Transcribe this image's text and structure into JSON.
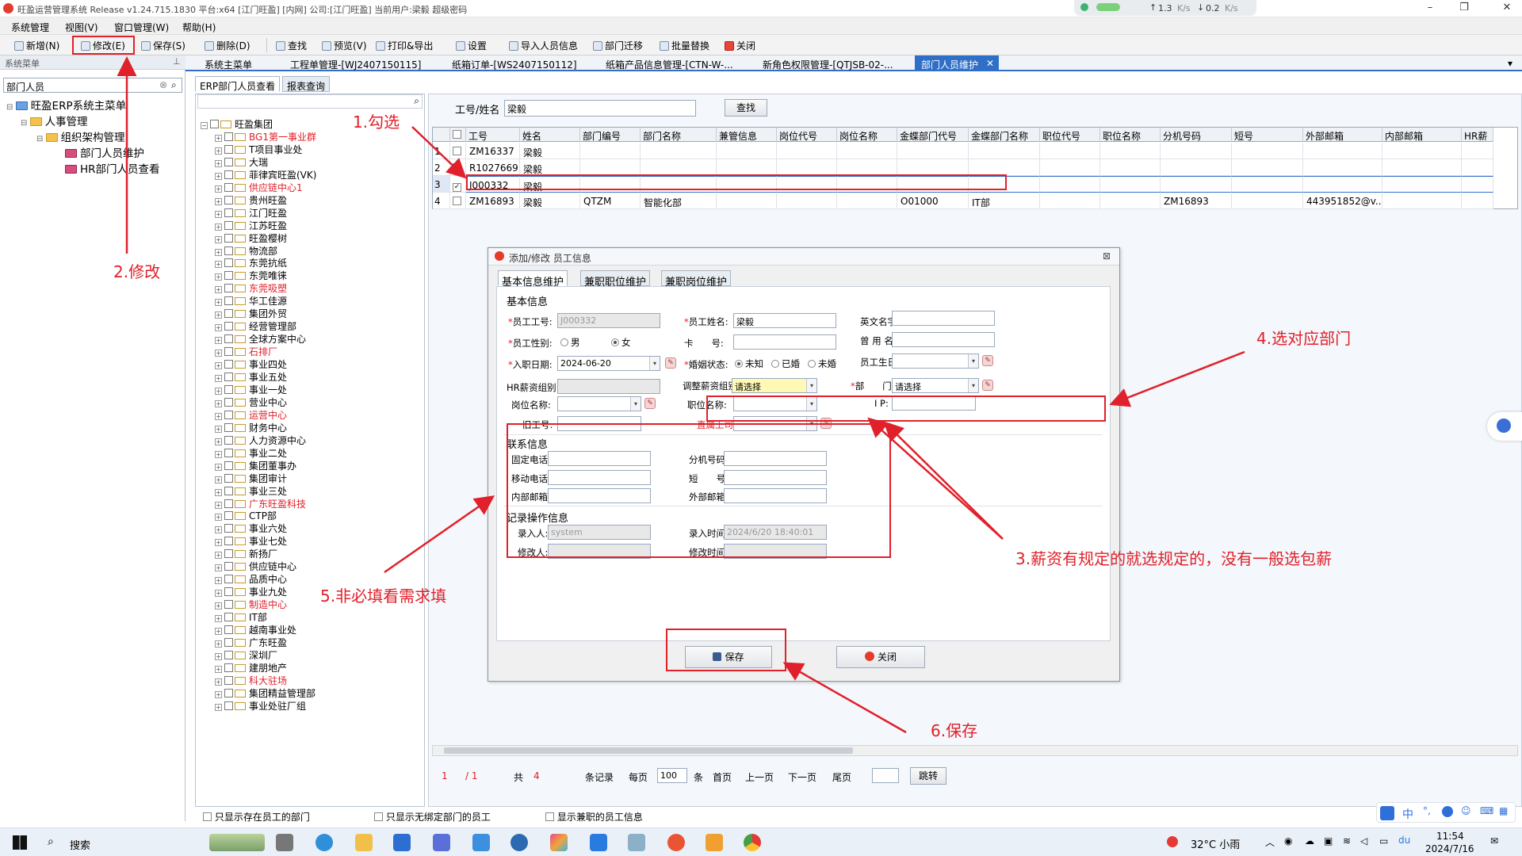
{
  "window": {
    "title": "旺盈运营管理系统 Release v1.24.715.1830 平台:x64   [江门旺盈] [内网] 公司:[江门旺盈] 当前用户:梁毅   超级密码",
    "net_up": "1.3",
    "net_down": "0.2",
    "net_unit": "K/s"
  },
  "menu": [
    "系统管理",
    "视图(V)",
    "窗口管理(W)",
    "帮助(H)"
  ],
  "toolbar": {
    "new": "新增(N)",
    "edit": "修改(E)",
    "save": "保存(S)",
    "delete": "删除(D)",
    "find": "查找",
    "preview": "预览(V)",
    "print": "打印&导出",
    "settings": "设置",
    "import": "导入人员信息",
    "migrate": "部门迁移",
    "batch": "批量替换",
    "close": "关闭"
  },
  "left": {
    "header": "系统菜单",
    "search_value": "部门人员",
    "tree": {
      "root": "旺盈ERP系统主菜单",
      "hr": "人事管理",
      "org": "组织架构管理",
      "item1": "部门人员维护",
      "item2": "HR部门人员查看"
    }
  },
  "doc_tabs": [
    "系统主菜单",
    "工程单管理-[WJ2407150115]",
    "纸箱订单-[WS2407150112]",
    "纸箱产品信息管理-[CTN-W-...",
    "新角色权限管理-[QTJSB-02-...",
    "部门人员维护"
  ],
  "sub_tabs": [
    "ERP部门人员查看",
    "报表查询"
  ],
  "search": {
    "label": "工号/姓名",
    "value": "梁毅",
    "button": "查找"
  },
  "org_tree": [
    {
      "t": "旺盈集团",
      "red": false
    },
    {
      "t": "BG1第一事业群",
      "red": true
    },
    {
      "t": "T项目事业处",
      "red": false
    },
    {
      "t": "大瑞",
      "red": false
    },
    {
      "t": "菲律宾旺盈(VK)",
      "red": false
    },
    {
      "t": "供应链中心1",
      "red": true
    },
    {
      "t": "贵州旺盈",
      "red": false
    },
    {
      "t": "江门旺盈",
      "red": false
    },
    {
      "t": "江苏旺盈",
      "red": false
    },
    {
      "t": "旺盈樱树",
      "red": false
    },
    {
      "t": "物流部",
      "red": false
    },
    {
      "t": "东莞抗纸",
      "red": false
    },
    {
      "t": "东莞唯徕",
      "red": false
    },
    {
      "t": "东莞吸塑",
      "red": true
    },
    {
      "t": "华工佳源",
      "red": false
    },
    {
      "t": "集团外贸",
      "red": false
    },
    {
      "t": "经营管理部",
      "red": false
    },
    {
      "t": "全球方案中心",
      "red": false
    },
    {
      "t": "石排厂",
      "red": true
    },
    {
      "t": "事业四处",
      "red": false
    },
    {
      "t": "事业五处",
      "red": false
    },
    {
      "t": "事业一处",
      "red": false
    },
    {
      "t": "营业中心",
      "red": false
    },
    {
      "t": "运营中心",
      "red": true
    },
    {
      "t": "财务中心",
      "red": false
    },
    {
      "t": "人力资源中心",
      "red": false
    },
    {
      "t": "事业二处",
      "red": false
    },
    {
      "t": "集团董事办",
      "red": false
    },
    {
      "t": "集团审计",
      "red": false
    },
    {
      "t": "事业三处",
      "red": false
    },
    {
      "t": "广东旺盈科技",
      "red": true
    },
    {
      "t": "CTP部",
      "red": false
    },
    {
      "t": "事业六处",
      "red": false
    },
    {
      "t": "事业七处",
      "red": false
    },
    {
      "t": "新扬厂",
      "red": false
    },
    {
      "t": "供应链中心",
      "red": false
    },
    {
      "t": "品质中心",
      "red": false
    },
    {
      "t": "事业九处",
      "red": false
    },
    {
      "t": "制造中心",
      "red": true
    },
    {
      "t": "IT部",
      "red": false
    },
    {
      "t": "越南事业处",
      "red": false
    },
    {
      "t": "广东旺盈",
      "red": false
    },
    {
      "t": "深圳厂",
      "red": false
    },
    {
      "t": "建朋地产",
      "red": false
    },
    {
      "t": "科大驻场",
      "red": true
    },
    {
      "t": "集团精益管理部",
      "red": false
    },
    {
      "t": "事业处驻厂组",
      "red": false
    }
  ],
  "grid": {
    "columns": [
      "工号",
      "姓名",
      "部门编号",
      "部门名称",
      "兼管信息",
      "岗位代号",
      "岗位名称",
      "金蝶部门代号",
      "金蝶部门名称",
      "职位代号",
      "职位名称",
      "分机号码",
      "短号",
      "外部邮箱",
      "内部邮箱",
      "HR薪"
    ],
    "rows": [
      {
        "num": "1",
        "checked": false,
        "cells": [
          "ZM16337",
          "梁毅",
          "",
          "",
          "",
          "",
          "",
          "",
          "",
          "",
          "",
          "",
          "",
          "",
          "",
          ""
        ]
      },
      {
        "num": "2",
        "checked": false,
        "cells": [
          "R1027669",
          "梁毅",
          "",
          "",
          "",
          "",
          "",
          "",
          "",
          "",
          "",
          "",
          "",
          "",
          "",
          ""
        ]
      },
      {
        "num": "3",
        "checked": true,
        "cells": [
          "J000332",
          "梁毅",
          "",
          "",
          "",
          "",
          "",
          "",
          "",
          "",
          "",
          "",
          "",
          "",
          "",
          ""
        ]
      },
      {
        "num": "4",
        "checked": false,
        "cells": [
          "ZM16893",
          "梁毅",
          "QTZM",
          "智能化部",
          "",
          "",
          "",
          "O01000",
          "IT部",
          "",
          "",
          "ZM16893",
          "",
          "443951852@v...",
          "",
          ""
        ]
      }
    ]
  },
  "dialog": {
    "title": "添加/修改 员工信息",
    "tabs": [
      "基本信息维护",
      "兼职职位维护",
      "兼职岗位维护"
    ],
    "sections": {
      "basic": "基本信息",
      "contact": "联系信息",
      "record": "记录操作信息"
    },
    "labels": {
      "emp_no": "员工工号:",
      "emp_name": "员工姓名:",
      "eng_name": "英文名字:",
      "gender": "员工性别:",
      "card": "卡　　号:",
      "used_name": "曾 用 名:",
      "join_date": "入职日期:",
      "marital": "婚姻状态:",
      "birthday": "员工生日:",
      "hr_salary": "HR薪资组别:",
      "adj_salary": "调整薪资组别",
      "dept": "部　　门:",
      "post_name": "岗位名称:",
      "job_name": "职位名称:",
      "ip": "I P:",
      "old_no": "旧工号:",
      "superior": "直属上司:",
      "phone": "固定电话:",
      "ext": "分机号码:",
      "mobile": "移动电话:",
      "short": "短　　号:",
      "inner_mail": "内部邮箱:",
      "outer_mail": "外部邮箱:",
      "entered_by": "录入人:",
      "entered_at": "录入时间:",
      "modified_by": "修改人:",
      "modified_at": "修改时间:"
    },
    "values": {
      "emp_no": "J000332",
      "emp_name": "梁毅",
      "join_date": "2024-06-20",
      "adj_salary": "请选择",
      "dept": "请选择",
      "entered_by": "system",
      "entered_at": "2024/6/20 18:40:01"
    },
    "gender_opts": [
      "男",
      "女"
    ],
    "marital_opts": [
      "未知",
      "已婚",
      "未婚"
    ],
    "buttons": {
      "save": "保存",
      "close": "关闭"
    }
  },
  "pager": {
    "page": "1",
    "pages": "/ 1",
    "total_label": "共",
    "total": "4",
    "records": "条记录",
    "per_page": "每页",
    "per_page_value": "100",
    "unit": "条",
    "first": "首页",
    "prev": "上一页",
    "next": "下一页",
    "last": "尾页",
    "jump": "跳转"
  },
  "bottom_checks": [
    "只显示存在员工的部门",
    "只显示无绑定部门的员工",
    "显示兼职的员工信息"
  ],
  "annotations": {
    "a1": "1.勾选",
    "a2": "2.修改",
    "a3": "3.薪资有规定的就选规定的，没有一般选包薪",
    "a4": "4.选对应部门",
    "a5": "5.非必填看需求填",
    "a6": "6.保存"
  },
  "taskbar": {
    "search": "搜索",
    "weather": "32°C 小雨",
    "ime": "中",
    "time": "11:54",
    "date": "2024/7/16"
  },
  "colors": {
    "accent": "#2f6fc7",
    "annotation": "#e0202a",
    "required": "#e0202a"
  }
}
